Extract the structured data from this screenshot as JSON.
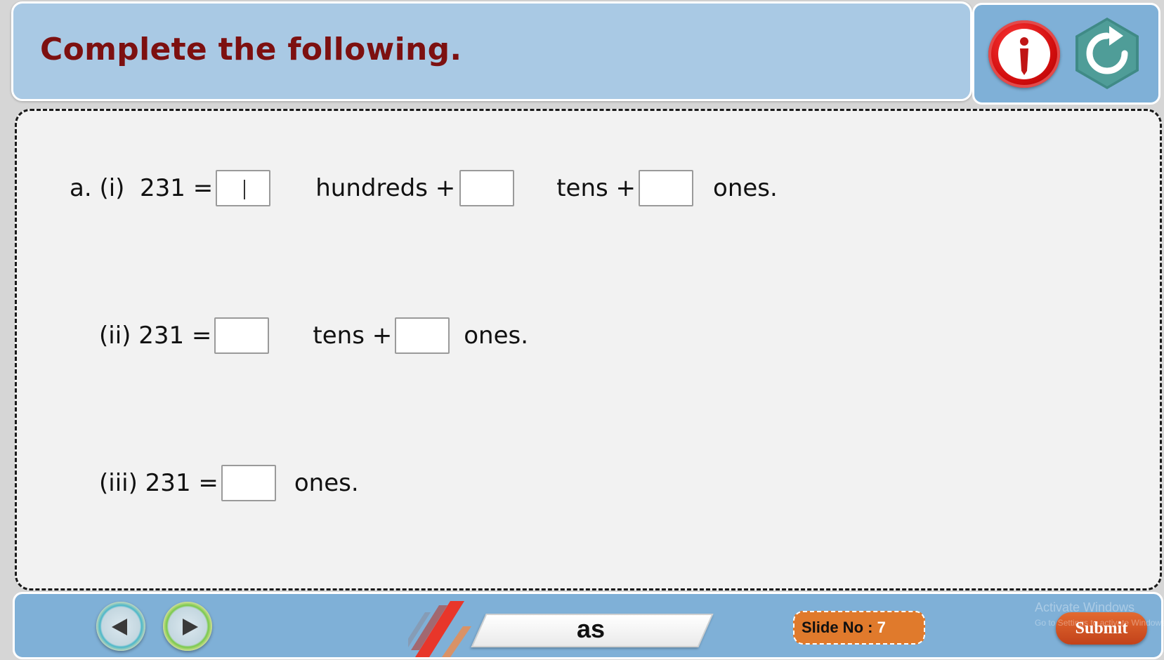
{
  "header": {
    "title": "Complete the following.",
    "info_icon": "info-icon",
    "reload_icon": "reload-icon"
  },
  "questions": {
    "q1": {
      "prefix": "a. (i)  231 =",
      "part1": "hundreds +",
      "part2": "tens +",
      "part3": "ones."
    },
    "q2": {
      "prefix": "(ii) 231 =",
      "part1": "tens +",
      "part2": "ones."
    },
    "q3": {
      "prefix": "(iii) 231 =",
      "part1": "ones."
    }
  },
  "footer": {
    "prev_icon": "chevron-left-icon",
    "next_icon": "chevron-right-icon",
    "label_text": "as",
    "slide_label": "Slide No : ",
    "slide_number": "7",
    "submit_label": "Submit",
    "watermark_line1": "Activate Windows",
    "watermark_line2": "Go to Settings to activate Windows."
  },
  "colors": {
    "title": "#7d1010",
    "panel_blue": "#a9c9e4",
    "footer_blue": "#7fb0d7",
    "slide_badge": "#e07a2c",
    "submit": "#d4521f",
    "info_red": "#d10d0d",
    "reload_teal": "#3f8a86"
  }
}
